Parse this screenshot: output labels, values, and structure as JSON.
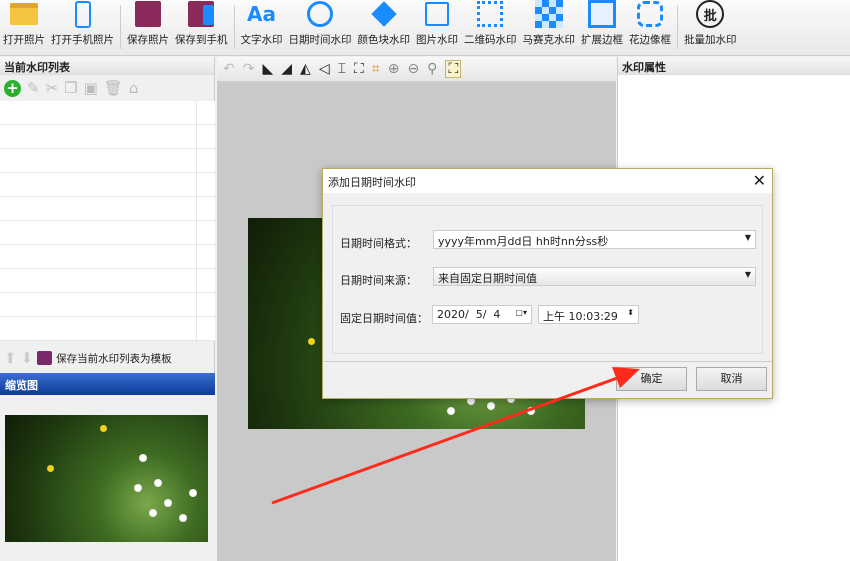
{
  "toolbar": {
    "items": [
      {
        "label": "打开照片",
        "icon": "open-folder-icon"
      },
      {
        "label": "打开手机照片",
        "icon": "phone-icon"
      },
      {
        "label": "保存照片",
        "icon": "save-icon"
      },
      {
        "label": "保存到手机",
        "icon": "save-to-phone-icon"
      },
      {
        "label": "文字水印",
        "icon": "text-icon",
        "glyph": "Aa"
      },
      {
        "label": "日期时间水印",
        "icon": "clock-icon"
      },
      {
        "label": "颜色块水印",
        "icon": "paint-bucket-icon"
      },
      {
        "label": "图片水印",
        "icon": "image-stamp-icon"
      },
      {
        "label": "二维码水印",
        "icon": "qrcode-icon"
      },
      {
        "label": "马赛克水印",
        "icon": "mosaic-icon"
      },
      {
        "label": "扩展边框",
        "icon": "extend-border-icon"
      },
      {
        "label": "花边像框",
        "icon": "lace-frame-icon"
      },
      {
        "label": "批量加水印",
        "icon": "batch-icon",
        "glyph": "批"
      }
    ]
  },
  "left_panel": {
    "title": "当前水印列表",
    "save_template": "保存当前水印列表为模板",
    "thumbnail_title": "缩览图"
  },
  "right_panel": {
    "title": "水印属性"
  },
  "dialog": {
    "title": "添加日期时间水印",
    "format_label": "日期时间格式：",
    "format_value": "yyyy年mm月dd日 hh时nn分ss秒",
    "source_label": "日期时间来源：",
    "source_value": "来自固定日期时间值",
    "fixed_label": "固定日期时间值：",
    "date_value": "2020/  5/  4",
    "time_value": "上午 10:03:29",
    "ok": "确定",
    "cancel": "取消"
  },
  "annotation_color": "#ff2a1a"
}
